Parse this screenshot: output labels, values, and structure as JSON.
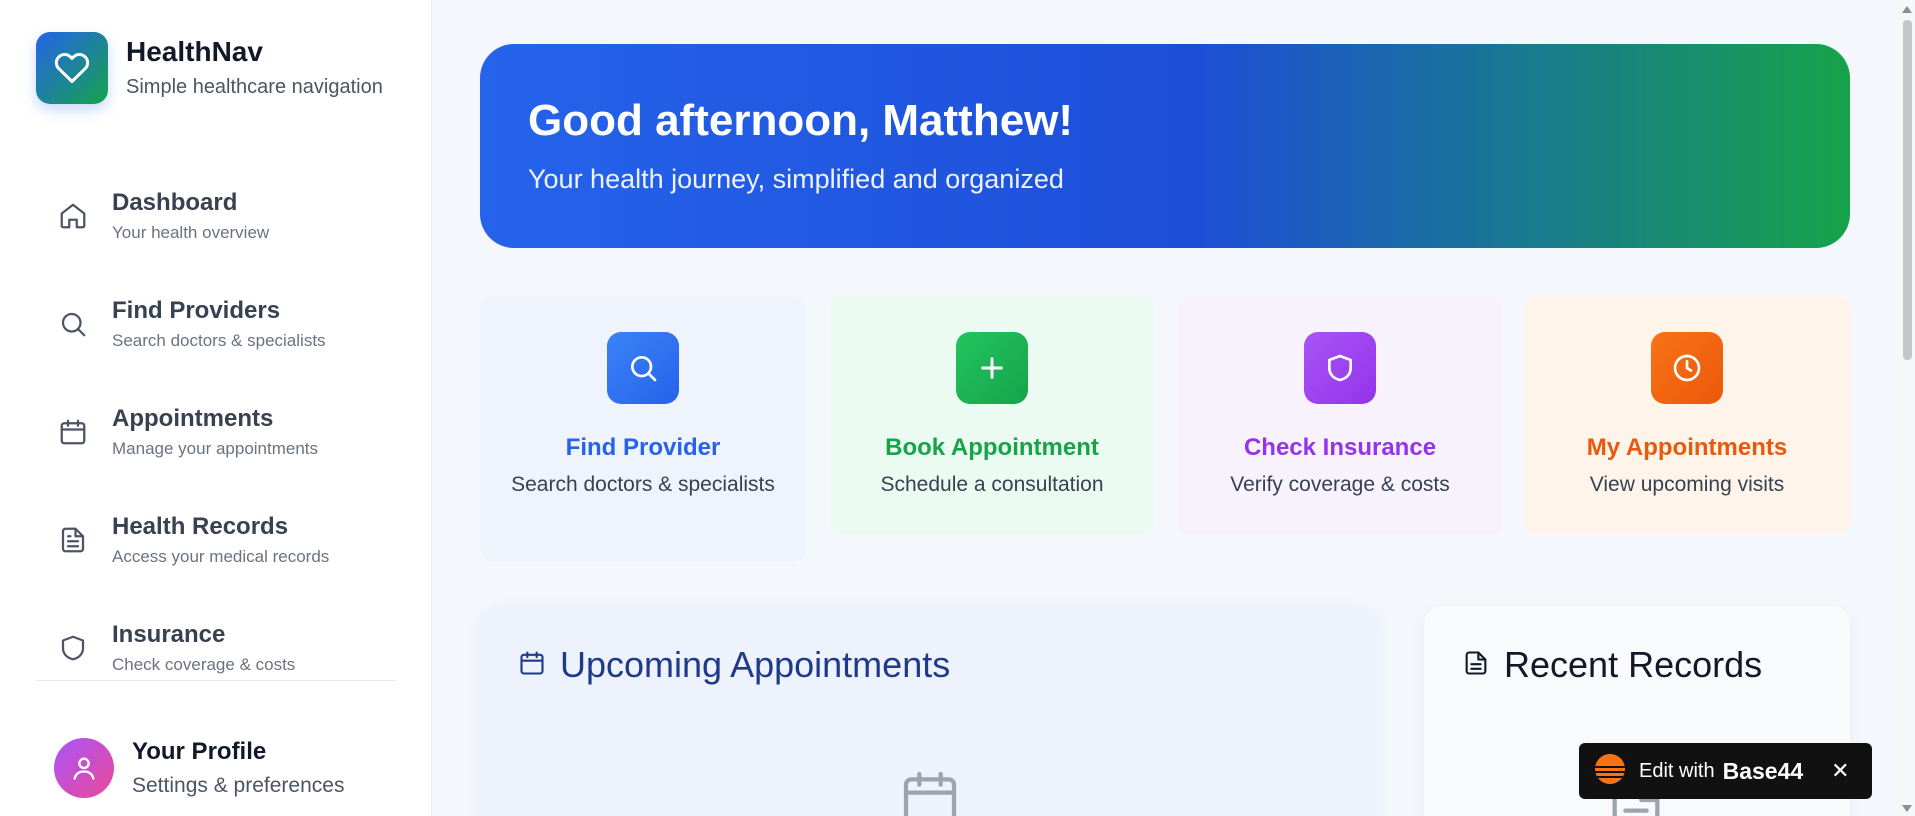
{
  "brand": {
    "title": "HealthNav",
    "subtitle": "Simple healthcare navigation"
  },
  "nav": [
    {
      "label": "Dashboard",
      "sub": "Your health overview",
      "icon": "home-icon"
    },
    {
      "label": "Find Providers",
      "sub": "Search doctors & specialists",
      "icon": "search-icon"
    },
    {
      "label": "Appointments",
      "sub": "Manage your appointments",
      "icon": "calendar-icon"
    },
    {
      "label": "Health Records",
      "sub": "Access your medical records",
      "icon": "document-icon"
    },
    {
      "label": "Insurance",
      "sub": "Check coverage & costs",
      "icon": "shield-icon"
    }
  ],
  "profile": {
    "name": "Your Profile",
    "sub": "Settings & preferences"
  },
  "hero": {
    "title": "Good afternoon, Matthew!",
    "subtitle": "Your health journey, simplified and organized"
  },
  "quick_actions": [
    {
      "title": "Find Provider",
      "sub": "Search doctors & specialists",
      "icon": "search-icon",
      "color": "#2563eb"
    },
    {
      "title": "Book Appointment",
      "sub": "Schedule a consultation",
      "icon": "plus-icon",
      "color": "#16a34a"
    },
    {
      "title": "Check Insurance",
      "sub": "Verify coverage & costs",
      "icon": "shield-icon",
      "color": "#9333ea"
    },
    {
      "title": "My Appointments",
      "sub": "View upcoming visits",
      "icon": "clock-icon",
      "color": "#ea580c"
    }
  ],
  "panels": {
    "upcoming_title": "Upcoming Appointments",
    "records_title": "Recent Records"
  },
  "badge": {
    "text": "Edit with",
    "brand": "Base44",
    "close": "✕"
  },
  "colors": {
    "primary": "#2563eb",
    "accent": "#16a34a",
    "purple": "#9333ea",
    "orange": "#ea580c"
  }
}
